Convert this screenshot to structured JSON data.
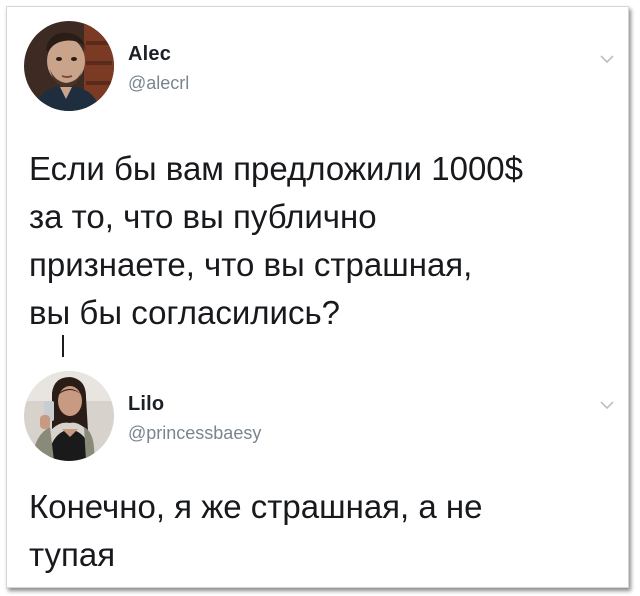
{
  "tweets": [
    {
      "display_name": "Alec",
      "handle": "@alecrl",
      "avatar_icon": "man-portrait-avatar",
      "menu_icon": "chevron-down-icon",
      "text_lines": [
        "Если бы вам предложили 1000$",
        "за то, что вы публично",
        "признаете, что вы страшная,",
        "вы бы согласились?"
      ]
    },
    {
      "display_name": "Lilo",
      "handle": "@princessbaesy",
      "avatar_icon": "woman-selfie-avatar",
      "menu_icon": "chevron-down-icon",
      "text_lines": [
        "Конечно, я же страшная, а не",
        "тупая"
      ]
    }
  ],
  "colors": {
    "name": "#1c2127",
    "handle": "#7a858f",
    "text": "#17191c",
    "chevron": "#b8c0c8"
  }
}
